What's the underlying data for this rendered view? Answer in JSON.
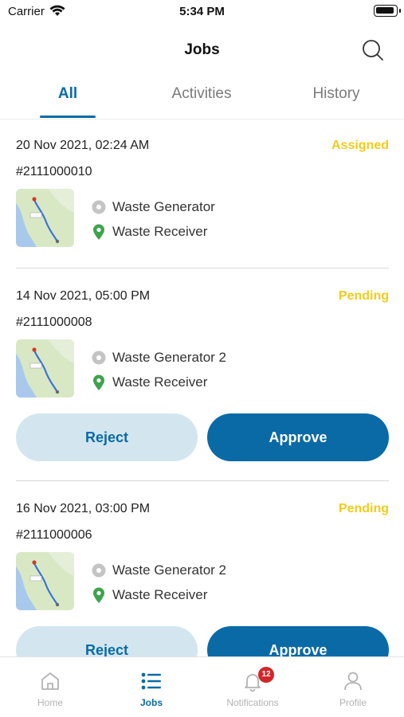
{
  "status_bar": {
    "carrier": "Carrier",
    "time": "5:34 PM"
  },
  "header": {
    "title": "Jobs"
  },
  "tabs": [
    {
      "label": "All",
      "active": true
    },
    {
      "label": "Activities",
      "active": false
    },
    {
      "label": "History",
      "active": false
    }
  ],
  "jobs": [
    {
      "date": "20 Nov 2021, 02:24 AM",
      "status": "Assigned",
      "id": "#2111000010",
      "from": "Waste Generator",
      "to": "Waste Receiver"
    },
    {
      "date": "14 Nov 2021, 05:00 PM",
      "status": "Pending",
      "id": "#2111000008",
      "from": "Waste Generator 2",
      "to": "Waste Receiver",
      "reject_label": "Reject",
      "approve_label": "Approve"
    },
    {
      "date": "16 Nov 2021, 03:00 PM",
      "status": "Pending",
      "id": "#2111000006",
      "from": "Waste Generator 2",
      "to": "Waste Receiver",
      "reject_label": "Reject",
      "approve_label": "Approve"
    }
  ],
  "tabbar": {
    "items": [
      {
        "label": "Home",
        "icon": "home-icon"
      },
      {
        "label": "Jobs",
        "icon": "list-icon",
        "active": true
      },
      {
        "label": "Notifications",
        "icon": "bell-icon",
        "badge": "12"
      },
      {
        "label": "Profile",
        "icon": "person-icon"
      }
    ]
  },
  "colors": {
    "primary": "#0a6aa6",
    "primary_light": "#d3e6f0",
    "status_yellow": "#f2cc1b",
    "badge_red": "#d3262a",
    "receiver_pin": "#3fa34d"
  }
}
